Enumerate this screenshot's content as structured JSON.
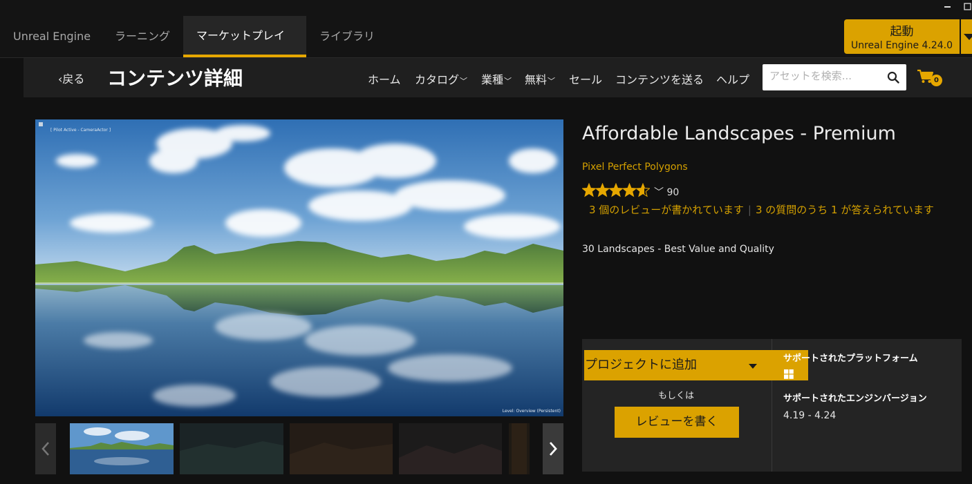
{
  "window_controls": {
    "minimize": "▬",
    "maximize": "☐"
  },
  "launcher": {
    "tabs": [
      "Unreal Engine",
      "ラーニング",
      "マーケットプレイス",
      "ライブラリ"
    ],
    "active_tab": "マーケットプレイス",
    "launch_label": "起動",
    "launch_version": "Unreal Engine 4.24.0"
  },
  "header": {
    "back_label": "‹戻る",
    "page_title": "コンテンツ詳細",
    "nav": {
      "home": "ホーム",
      "catalog": "カタログ",
      "industry": "業種",
      "free": "無料",
      "sale": "セール",
      "submit": "コンテンツを送る",
      "help": "ヘルプ"
    },
    "search_placeholder": "アセットを検索...",
    "cart_count": "0"
  },
  "hero": {
    "caption_top_left": "[ Pilot Active - CameraActor ]",
    "caption_bottom_right": "Level: Overview (Persistent)"
  },
  "product": {
    "title": "Affordable Landscapes - Premium",
    "seller": "Pixel Perfect Polygons",
    "rating": 4.6,
    "rating_count": "90",
    "reviews_text": "3 個のレビューが書かれています",
    "questions_text": "3 の質問のうち 1 が答えられています",
    "tagline": "30 Landscapes - Best Value and Quality"
  },
  "purchase": {
    "add_to_project": "プロジェクトに追加",
    "or": "もしくは",
    "write_review": "レビューを書く",
    "platforms_title": "サポートされたプラットフォーム",
    "engine_title": "サポートされたエンジンバージョン",
    "engine_versions": "4.19 - 4.24"
  },
  "colors": {
    "accent": "#dba200",
    "link": "#d4a000",
    "background": "#111111",
    "panel": "#242424"
  }
}
